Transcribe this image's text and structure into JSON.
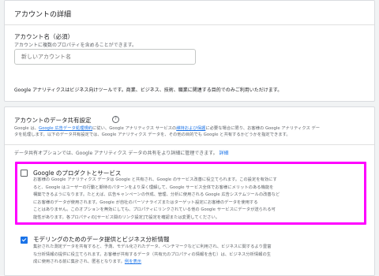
{
  "account_details": {
    "title": "アカウントの詳細",
    "name_label": "アカウント名（必須）",
    "name_hint": "アカウントに複数のプロパティを含めることができます。",
    "name_placeholder": "新しいアカウント名",
    "notice": "Google アナリティクスはビジネス向けツールです。商業、ビジネス、技術、職業に関連する目的でのみご利用いただけます。"
  },
  "data_sharing": {
    "title": "アカウントのデータ共有設定",
    "help_icon": "help-circle-icon",
    "intro_line1_pre": "Google は、",
    "intro_line1_link1": "Google 広告データ処理規約",
    "intro_line1_mid": "に従い、Google アナリティクス サービスの",
    "intro_line1_link2": "維持および保護",
    "intro_line1_post": "に必要な場合に限り、お客様の Google アナリティクス デー",
    "intro_line2": "タを処理します。以下のデータ共有設定では、Google アナリティクス データを、その他の目的でも Google と共有するかどうかを指定できます。",
    "options_note": "データ共有オプションでは、Google アナリティクス データの共有をより詳細に管理できます。",
    "options_note_link": "詳細",
    "option1": {
      "title": "Google のプロダクトとサービス",
      "checked": false,
      "lines": [
        "お客様の Google アナリティクス データは Google と共有され、Google のサービス改善に役立てられます。この設定を有効にす",
        "ると、Google はユーザーの行動と期待のパターンをより深く理解して、Google サービス全体でお客様にメリットのある機能を",
        "構築できるようになります。たとえば、広告キャンペーンの作成、管理、分析に使用される Google 広告システムツールの改善など",
        "にお客様のデータが使用されます。Google が自社のパーソナライズまたはターゲット設定にお客様のデータを使用する",
        "ことはありません。このオプションを無効にしても、プロパティにリンクされている他の Google サービスにデータが送られる可",
        "能性があります。各プロパティの[サービス間のリンク設定]で設定を確認または変更してください。"
      ]
    },
    "option2": {
      "title": "モデリングのためのデータ提供とビジネス分析情報",
      "checked": true,
      "lines": [
        "集計された測定データを共有すると、予測、モデル化されたデータ、ベンチマークなどに利用され、ビジネスに関するより豊富",
        "な分析情報の提供に役立てられます。お客様が共有するデータ（共有元のプロパティの情報を含む）は、ビジネス分析情報の生",
        "成に使用される前に集計され、匿名となります。"
      ],
      "link": "例を表示"
    }
  }
}
